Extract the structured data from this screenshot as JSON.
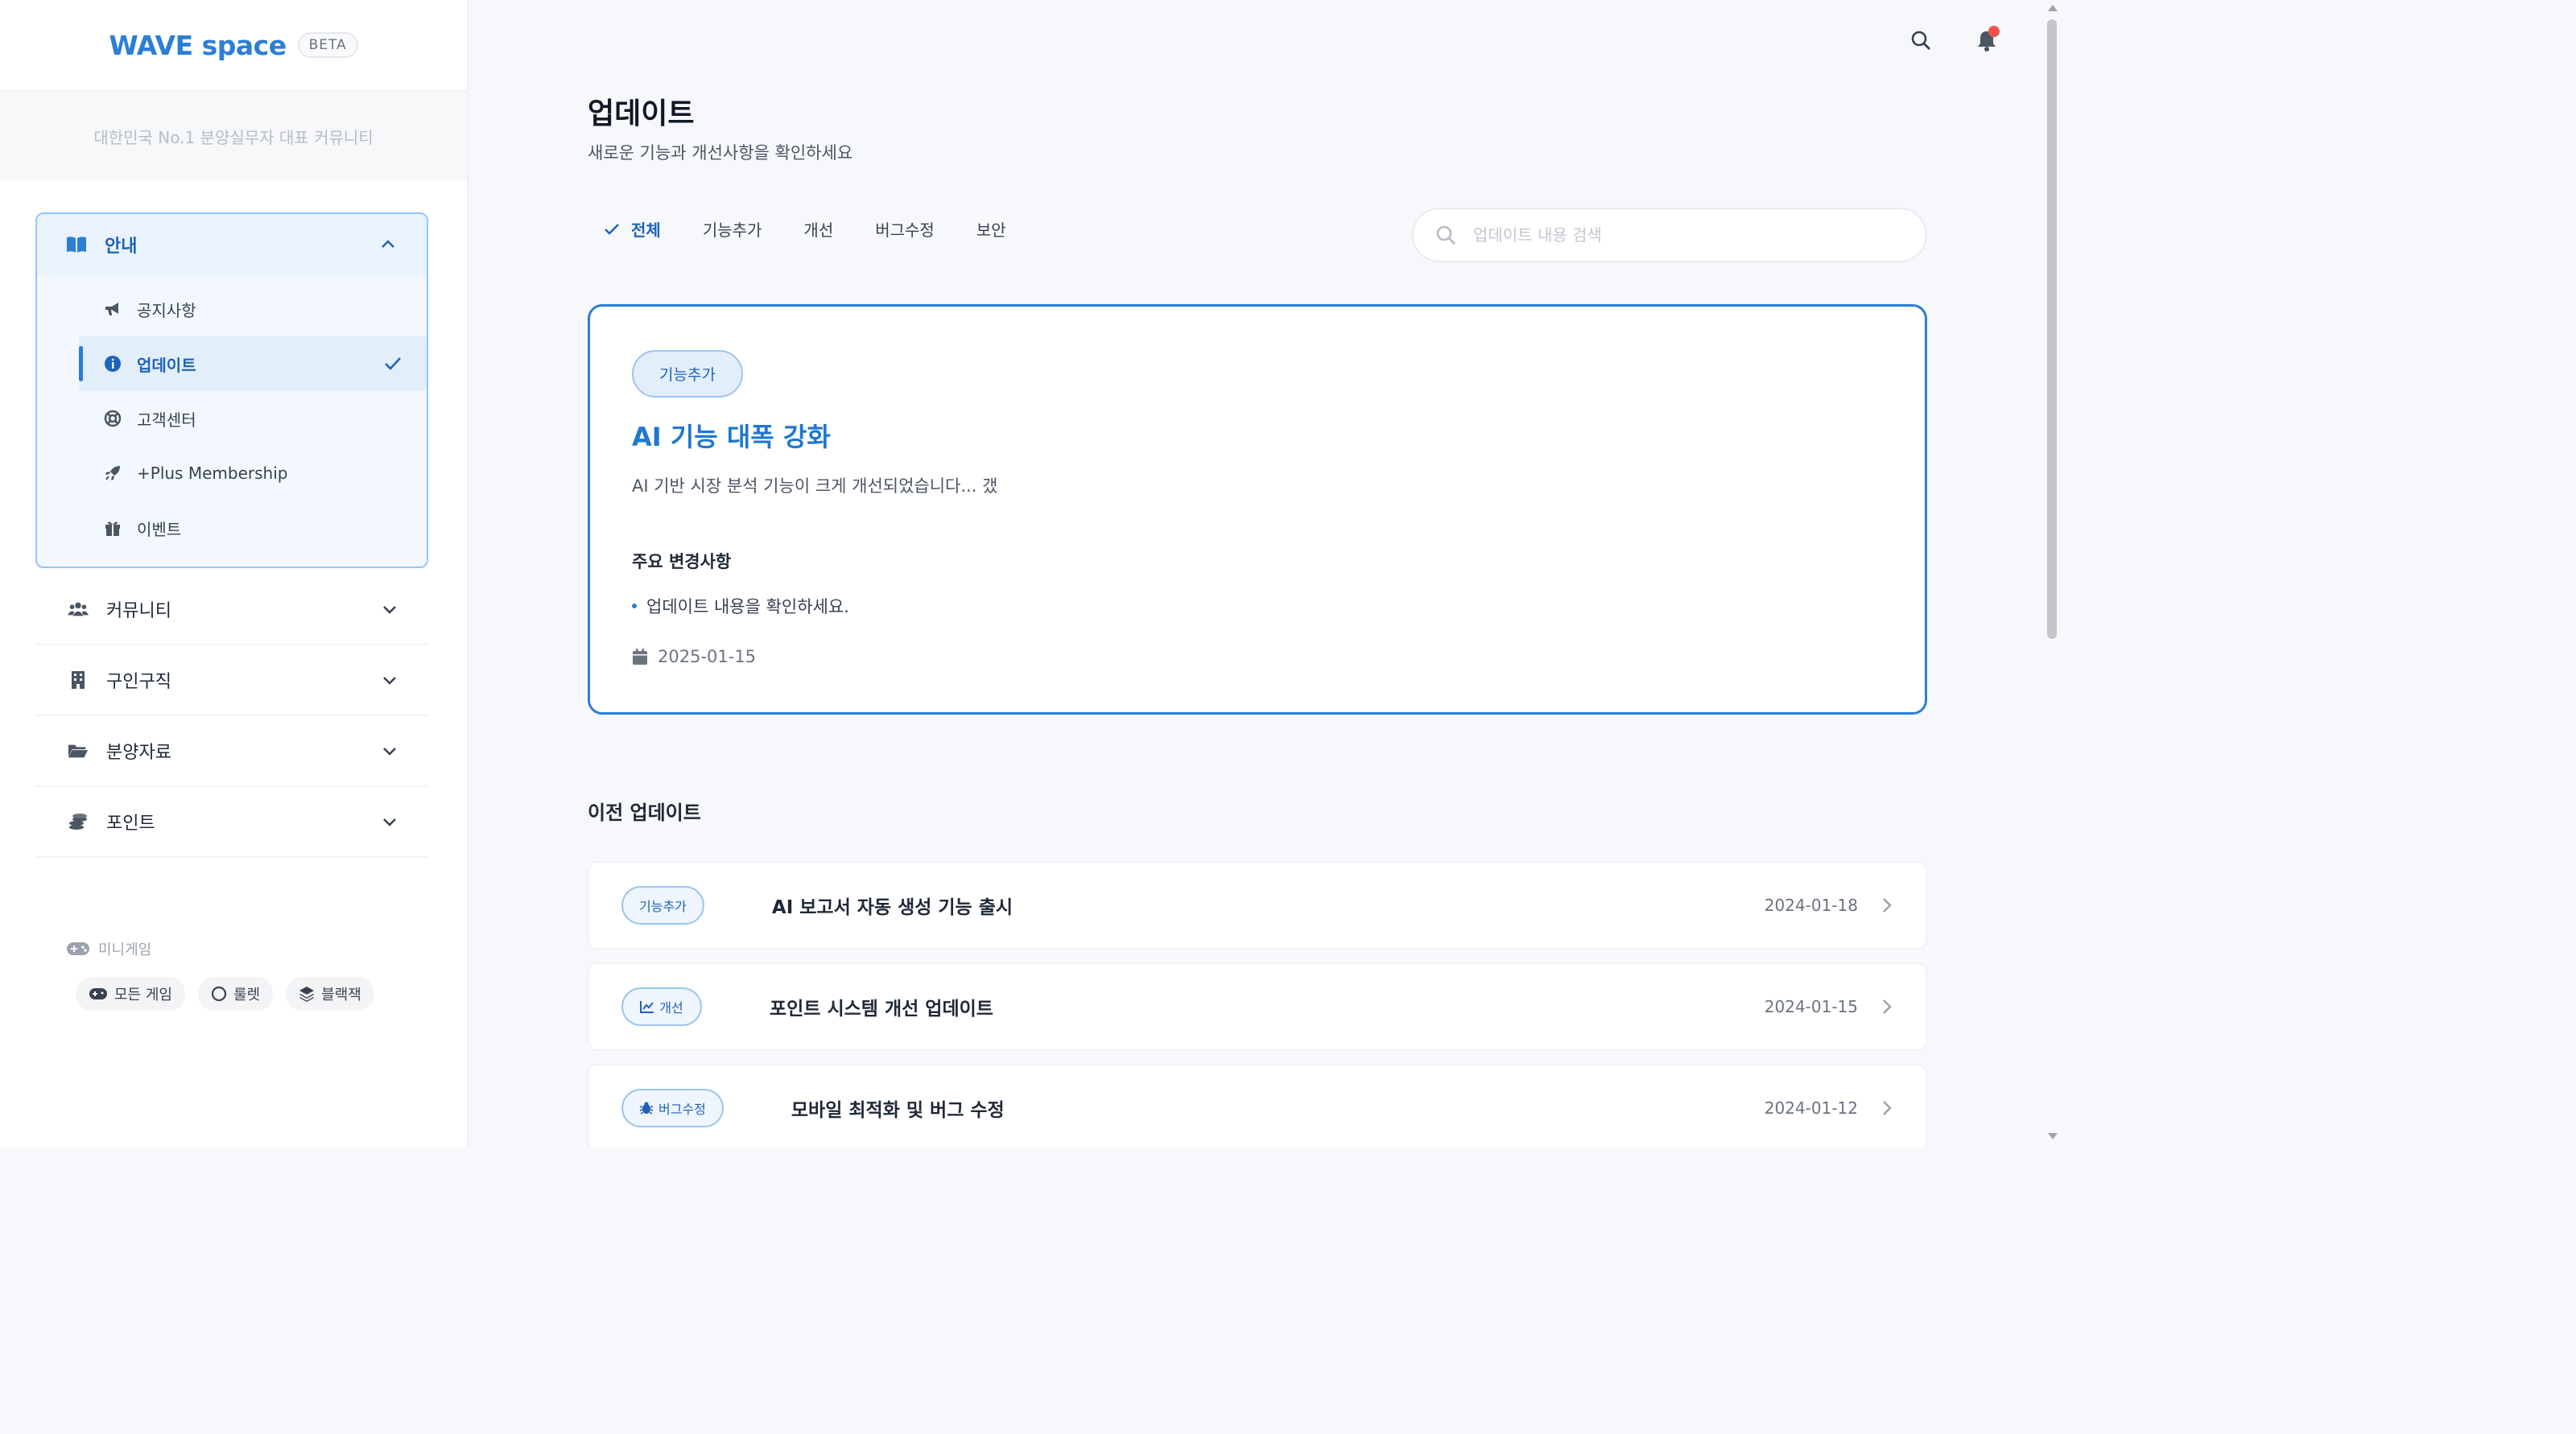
{
  "brand": {
    "name": "WAVE space",
    "badge": "BETA",
    "tagline": "대한민국 No.1 분양실무자 대표 커뮤니티"
  },
  "sidebar": {
    "open_group": {
      "label": "안내",
      "items": [
        {
          "label": "공지사항",
          "icon": "megaphone-icon"
        },
        {
          "label": "업데이트",
          "icon": "info-icon",
          "active": true
        },
        {
          "label": "고객센터",
          "icon": "lifebuoy-icon"
        },
        {
          "label": "+Plus Membership",
          "icon": "rocket-icon"
        },
        {
          "label": "이벤트",
          "icon": "gift-icon"
        }
      ]
    },
    "groups": [
      {
        "label": "커뮤니티",
        "icon": "users-icon"
      },
      {
        "label": "구인구직",
        "icon": "building-icon"
      },
      {
        "label": "분양자료",
        "icon": "folder-icon"
      },
      {
        "label": "포인트",
        "icon": "coins-icon"
      }
    ],
    "mini_game": {
      "title": "미니게임",
      "tags": [
        {
          "label": "모든 게임",
          "icon": "gamepad-icon"
        },
        {
          "label": "룰렛",
          "icon": "circle-icon"
        },
        {
          "label": "블랙잭",
          "icon": "layers-icon"
        }
      ]
    }
  },
  "header": {
    "title": "업데이트",
    "subtitle": "새로운 기능과 개선사항을 확인하세요"
  },
  "filters": [
    "전체",
    "기능추가",
    "개선",
    "버그수정",
    "보안"
  ],
  "search": {
    "placeholder": "업데이트 내용 검색"
  },
  "featured": {
    "badge": "기능추가",
    "title": "AI 기능 대폭 강화",
    "desc": "AI 기반 시장 분석 기능이 크게 개선되었습니다... 갰",
    "section": "주요 변경사항",
    "bullet": "업데이트 내용을 확인하세요.",
    "date": "2025-01-15"
  },
  "previous": {
    "title": "이전 업데이트",
    "items": [
      {
        "badge": "기능추가",
        "title": "AI 보고서 자동 생성 기능 출시",
        "date": "2024-01-18"
      },
      {
        "badge": "개선",
        "title": "포인트 시스템 개선 업데이트",
        "date": "2024-01-15",
        "icon": "chart-icon"
      },
      {
        "badge": "버그수정",
        "title": "모바일 최적화 및 버그 수정",
        "date": "2024-01-12",
        "icon": "bug-icon"
      }
    ]
  },
  "colors": {
    "accent": "#2b7fd4",
    "notification": "#ef5350"
  }
}
